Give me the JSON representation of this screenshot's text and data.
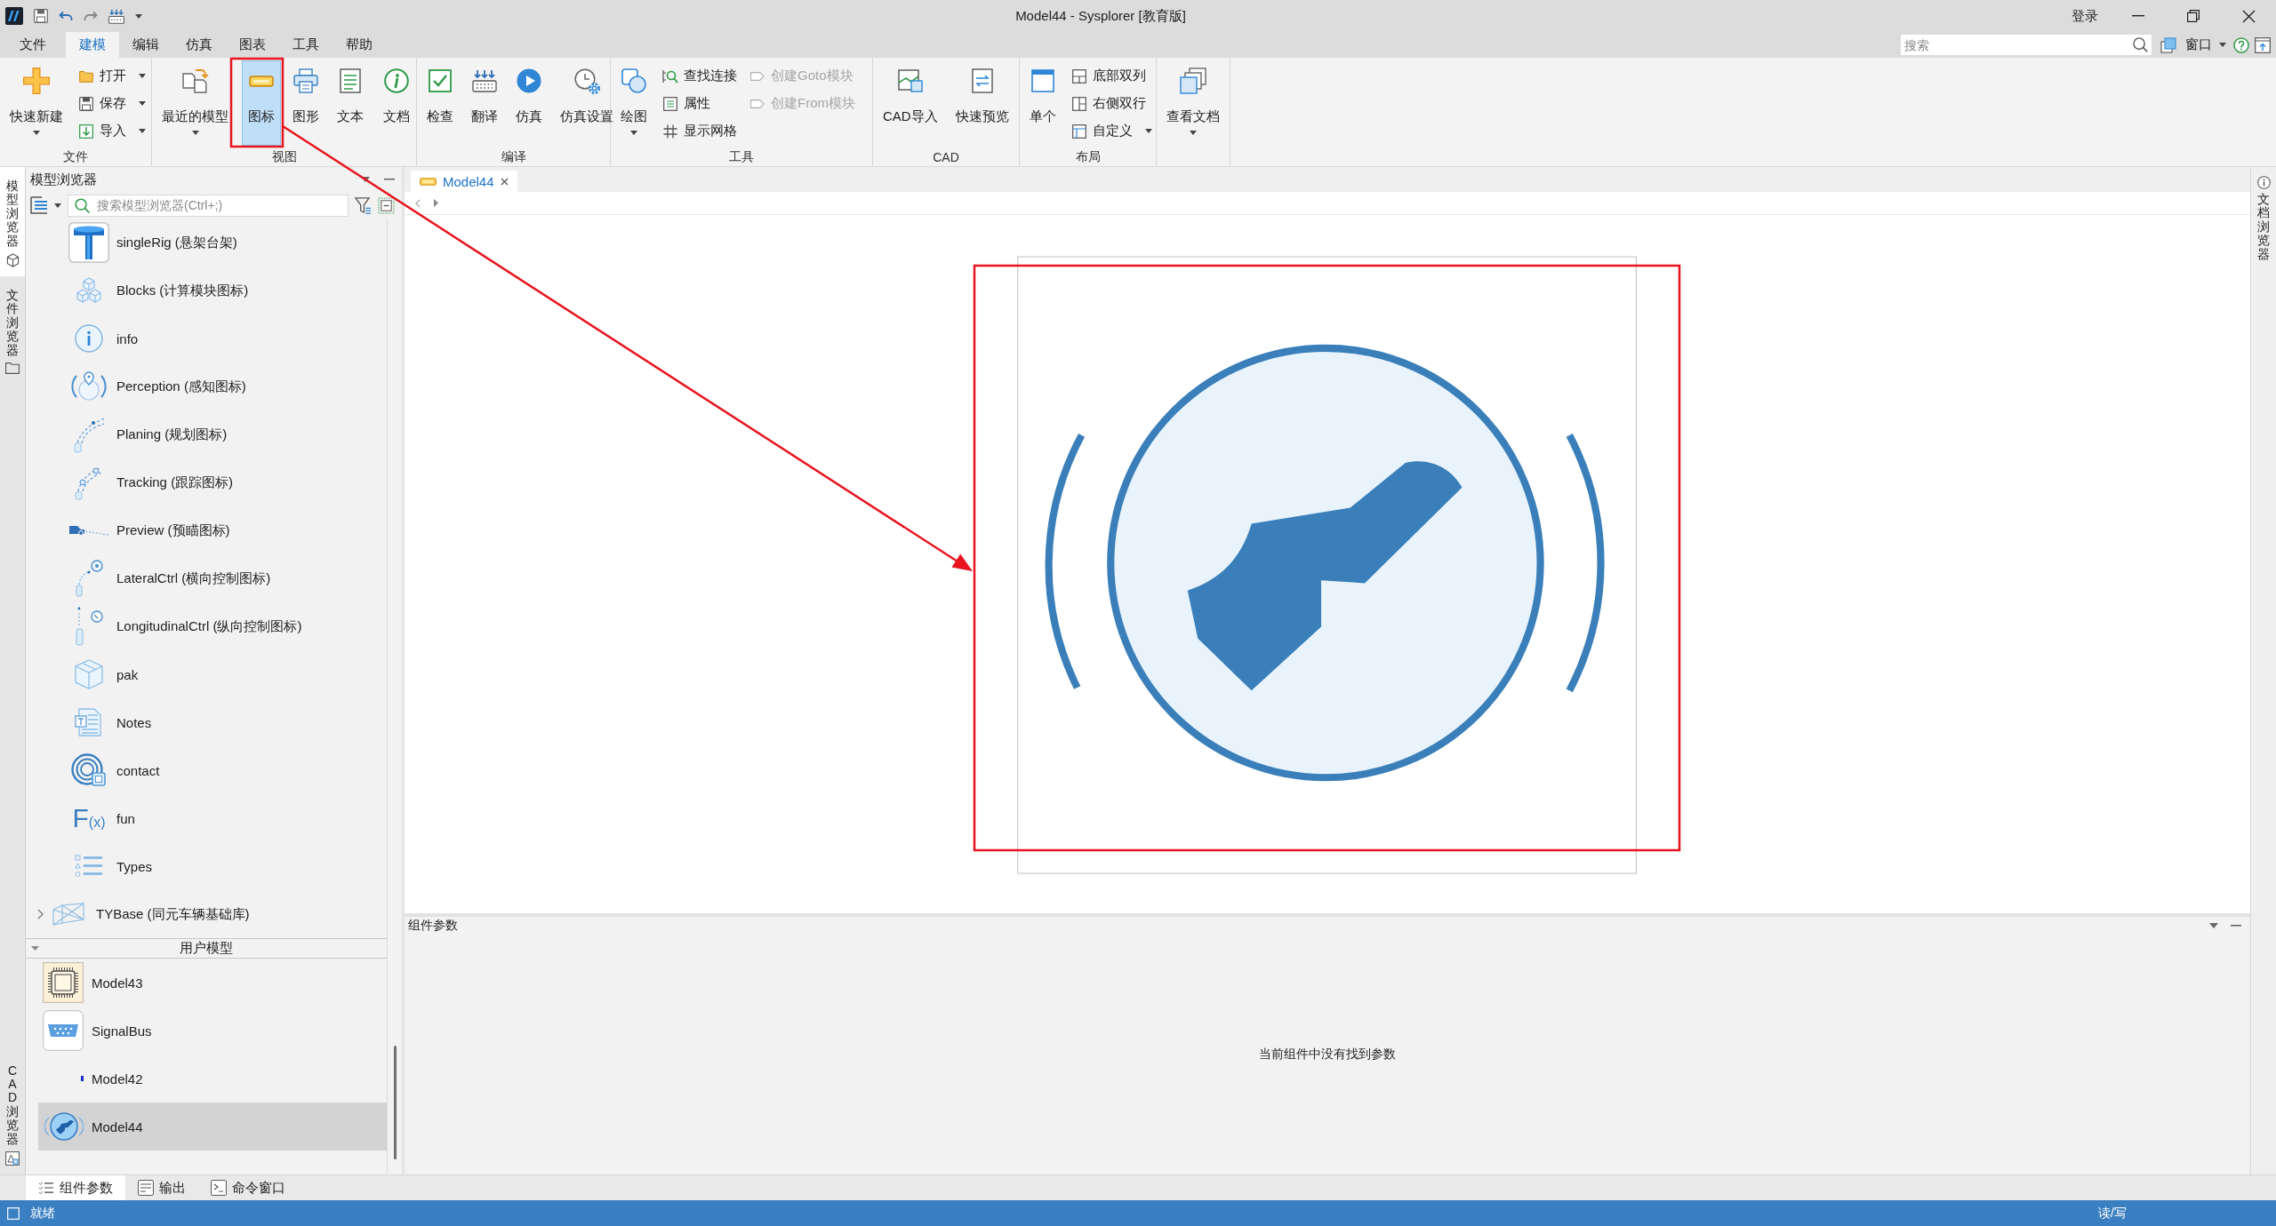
{
  "window": {
    "title": "Model44 - Sysplorer [教育版]",
    "login": "登录"
  },
  "menu": [
    {
      "label": "文件",
      "selected": false
    },
    {
      "label": "建模",
      "selected": true
    },
    {
      "label": "编辑",
      "selected": false
    },
    {
      "label": "仿真",
      "selected": false
    },
    {
      "label": "图表",
      "selected": false
    },
    {
      "label": "工具",
      "selected": false
    },
    {
      "label": "帮助",
      "selected": false
    }
  ],
  "menu_right": {
    "search": {
      "placeholder": "搜索"
    },
    "window_button": "窗口"
  },
  "ribbon": [
    {
      "label": "文件",
      "items": [
        {
          "kind": "large",
          "label": "快速新建",
          "dropdown": true,
          "selected": false,
          "disabled": false
        },
        {
          "kind": "stack",
          "buttons": [
            {
              "label": "打开",
              "dropdown": true,
              "disabled": false
            },
            {
              "label": "保存",
              "dropdown": true,
              "disabled": false
            },
            {
              "label": "导入",
              "dropdown": true,
              "disabled": false
            }
          ]
        }
      ]
    },
    {
      "label": "视图",
      "items": [
        {
          "kind": "large",
          "label": "最近的模型",
          "dropdown": true,
          "selected": false,
          "disabled": false
        },
        {
          "kind": "separator"
        },
        {
          "kind": "large",
          "label": "图标",
          "dropdown": false,
          "selected": true,
          "disabled": false
        },
        {
          "kind": "large",
          "label": "图形",
          "dropdown": false,
          "selected": false,
          "disabled": false
        },
        {
          "kind": "large",
          "label": "文本",
          "dropdown": false,
          "selected": false,
          "disabled": false
        },
        {
          "kind": "separator"
        },
        {
          "kind": "large",
          "label": "文档",
          "dropdown": false,
          "selected": false,
          "disabled": false
        }
      ]
    },
    {
      "label": "编译",
      "items": [
        {
          "kind": "large",
          "label": "检查",
          "dropdown": false,
          "selected": false,
          "disabled": false
        },
        {
          "kind": "large",
          "label": "翻译",
          "dropdown": false,
          "selected": false,
          "disabled": false
        },
        {
          "kind": "large",
          "label": "仿真",
          "dropdown": false,
          "selected": false,
          "disabled": false
        },
        {
          "kind": "large",
          "label": "仿真设置",
          "dropdown": false,
          "selected": false,
          "disabled": false
        }
      ]
    },
    {
      "label": "工具",
      "items": [
        {
          "kind": "large",
          "label": "绘图",
          "dropdown": true,
          "selected": false,
          "disabled": false
        },
        {
          "kind": "stack",
          "buttons": [
            {
              "label": "查找连接",
              "dropdown": false,
              "disabled": false
            },
            {
              "label": "属性",
              "dropdown": false,
              "disabled": false
            },
            {
              "label": "显示网格",
              "dropdown": false,
              "disabled": false
            }
          ]
        },
        {
          "kind": "stack",
          "buttons": [
            {
              "label": "创建Goto模块",
              "dropdown": false,
              "disabled": true
            },
            {
              "label": "创建From模块",
              "dropdown": false,
              "disabled": true
            }
          ]
        }
      ]
    },
    {
      "label": "CAD",
      "items": [
        {
          "kind": "large",
          "label": "CAD导入",
          "dropdown": false,
          "selected": false,
          "disabled": false
        },
        {
          "kind": "large",
          "label": "快速预览",
          "dropdown": false,
          "selected": false,
          "disabled": false
        }
      ]
    },
    {
      "label": "布局",
      "items": [
        {
          "kind": "large",
          "label": "单个",
          "dropdown": false,
          "selected": false,
          "disabled": false
        },
        {
          "kind": "stack",
          "buttons": [
            {
              "label": "底部双列",
              "dropdown": false,
              "disabled": false
            },
            {
              "label": "右侧双行",
              "dropdown": false,
              "disabled": false
            },
            {
              "label": "自定义",
              "dropdown": true,
              "disabled": false
            }
          ]
        }
      ]
    },
    {
      "items": [
        {
          "kind": "large",
          "label": "查看文档",
          "dropdown": true,
          "selected": false,
          "disabled": false
        }
      ]
    }
  ],
  "side_tabs": [
    {
      "label": "模型浏览器",
      "selected": true
    },
    {
      "label": "文件浏览器",
      "selected": false
    },
    {
      "label": "CAD 浏览器",
      "selected": false
    }
  ],
  "model_browser": {
    "title": "模型浏览器",
    "search": {
      "placeholder": "搜索模型浏览器(Ctrl+;)"
    },
    "tree": [
      {
        "children": [
          {
            "label": "singleRig (悬架台架)"
          },
          {
            "label": "Blocks (计算模块图标)"
          },
          {
            "label": "info"
          },
          {
            "label": "Perception (感知图标)"
          },
          {
            "label": "Planing (规划图标)"
          },
          {
            "label": "Tracking (跟踪图标)"
          },
          {
            "label": "Preview (预瞄图标)"
          },
          {
            "label": "LateralCtrl (横向控制图标)"
          },
          {
            "label": "LongitudinalCtrl (纵向控制图标)"
          },
          {
            "label": "pak"
          },
          {
            "label": "Notes"
          },
          {
            "label": "contact"
          },
          {
            "label": "fun",
            "symbol": "F$_{(x)}$"
          },
          {
            "label": "Types"
          }
        ]
      },
      {
        "label": "TYBase (同元车辆基础库)",
        "expanded": false
      }
    ],
    "user_models": {
      "label": "用户模型",
      "expanded": true,
      "items": [
        {
          "label": "Model43",
          "selected": false
        },
        {
          "label": "SignalBus",
          "selected": false
        },
        {
          "label": "Model42",
          "selected": false
        },
        {
          "label": "Model44",
          "selected": true
        }
      ]
    }
  },
  "editor": {
    "tabs": [
      {
        "label": "Model44",
        "selected": true
      }
    ]
  },
  "doc_browser": {
    "label": "文档浏览器"
  },
  "params_panel": {
    "title": "组件参数",
    "message": "当前组件中没有找到参数"
  },
  "bottom_tabs": [
    {
      "label": "组件参数",
      "selected": true
    },
    {
      "label": "输出",
      "selected": false
    },
    {
      "label": "命令窗口",
      "selected": false
    }
  ],
  "status_bar": {
    "text": "就绪",
    "mode": "读/写"
  }
}
